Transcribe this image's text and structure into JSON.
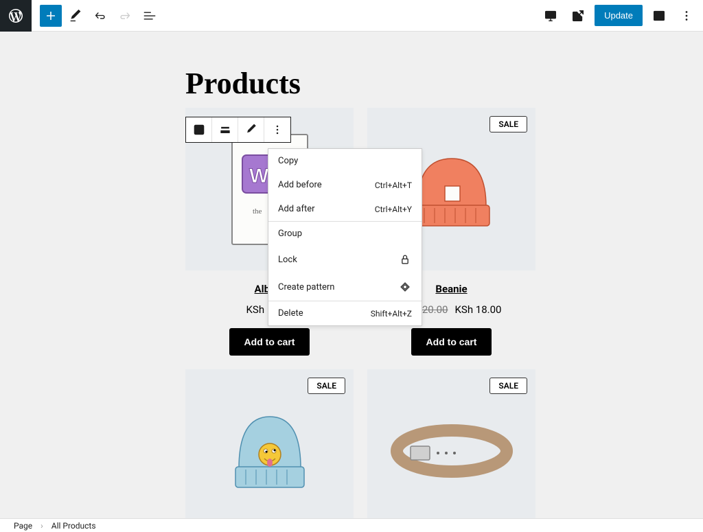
{
  "toolbar": {
    "update_label": "Update"
  },
  "page": {
    "title": "Products"
  },
  "menu": {
    "copy": "Copy",
    "add_before": "Add before",
    "add_before_shortcut": "Ctrl+Alt+T",
    "add_after": "Add after",
    "add_after_shortcut": "Ctrl+Alt+Y",
    "group": "Group",
    "lock": "Lock",
    "create_pattern": "Create pattern",
    "delete": "Delete",
    "delete_shortcut": "Shift+Alt+Z"
  },
  "products": [
    {
      "name": "Album",
      "price": "KSh 15.00",
      "sale": false,
      "cta": "Add to cart"
    },
    {
      "name": "Beanie",
      "price_old": "KSh 20.00",
      "price": "KSh 18.00",
      "sale": true,
      "sale_label": "SALE",
      "cta": "Add to cart"
    },
    {
      "sale": true,
      "sale_label": "SALE"
    },
    {
      "sale": true,
      "sale_label": "SALE"
    }
  ],
  "breadcrumb": {
    "root": "Page",
    "current": "All Products"
  }
}
